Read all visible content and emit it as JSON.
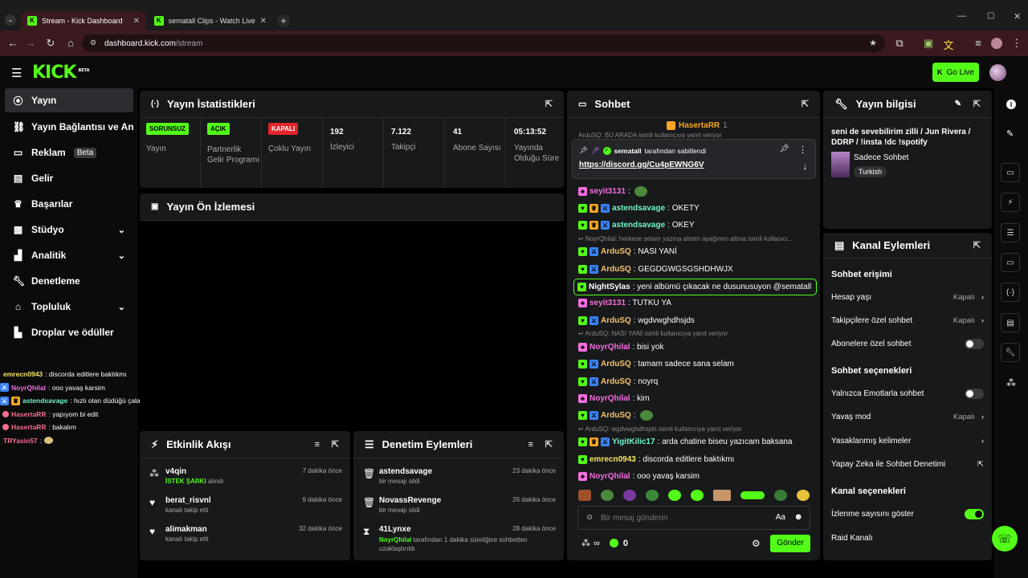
{
  "browser": {
    "tabs": [
      {
        "title": "Stream - Kick Dashboard",
        "active": true
      },
      {
        "title": "sematall Clips - Watch Live on Kick",
        "active": false
      }
    ],
    "url_host": "dashboard.kick.com",
    "url_path": "/stream"
  },
  "header": {
    "logo": "KICK",
    "logo_badge": "BETA",
    "go_live": "Go Live"
  },
  "sidebar": {
    "items": [
      {
        "label": "Yayın",
        "icon": "broadcast-icon",
        "active": true
      },
      {
        "label": "Yayın Bağlantısı ve Anahtarı",
        "icon": "link-icon"
      },
      {
        "label": "Reklam",
        "icon": "ad-icon",
        "badge": "Beta"
      },
      {
        "label": "Gelir",
        "icon": "revenue-icon"
      },
      {
        "label": "Başarılar",
        "icon": "trophy-icon"
      },
      {
        "label": "Stüdyo",
        "icon": "studio-icon",
        "expandable": true
      },
      {
        "label": "Analitik",
        "icon": "analytics-icon",
        "expandable": true
      },
      {
        "label": "Denetleme",
        "icon": "wrench-icon"
      },
      {
        "label": "Topluluk",
        "icon": "community-icon",
        "expandable": true
      },
      {
        "label": "Droplar ve ödüller",
        "icon": "drops-icon"
      }
    ],
    "mini_chat": [
      {
        "user": "emrecn0943",
        "text": " : discorda editlere baktıkmı",
        "color": "#f5e663"
      },
      {
        "user": "NoyrQhilal",
        "text": " : ooo yavaş karsim",
        "color": "#f56edf"
      },
      {
        "user": "astendsavage",
        "text": " : hızlı olan düdüğü çalar hesabı",
        "color": "#6ef5c8"
      },
      {
        "user": "HasertaRR",
        "text": " : yapıyom bi edit",
        "color": "#f56e8e"
      },
      {
        "user": "HasertaRR",
        "text": " : bakalım",
        "color": "#f56e8e"
      },
      {
        "user": "TRYasin57",
        "text": " :",
        "color": "#f56e8e"
      }
    ]
  },
  "stats": {
    "title": "Yayın İstatistikleri",
    "cells": [
      {
        "badge": "SORUNSUZ",
        "badge_color": "#53fc18",
        "label": "Yayın"
      },
      {
        "badge": "AÇIK",
        "badge_color": "#53fc18",
        "label": "Partnerlik Gelir Programı"
      },
      {
        "badge": "KAPALI",
        "badge_color": "#e3242b",
        "label": "Çoklu Yayın"
      },
      {
        "value": "192",
        "label": "İzleyici"
      },
      {
        "value": "7.122",
        "label": "Takipçi"
      },
      {
        "value": "41",
        "label": "Abone Sayısı"
      },
      {
        "value": "05:13:52",
        "label": "Yayında Olduğu Süre"
      }
    ]
  },
  "preview": {
    "title": "Yayın Ön İzlemesi"
  },
  "activity": {
    "title": "Etkinlik Akışı",
    "rows": [
      {
        "user": "v4qin",
        "sub_highlight": "İSTEK ŞARKI",
        "sub": " alındı",
        "time": "7 dakika önce",
        "icon": "redeem-icon"
      },
      {
        "user": "berat_risvnl",
        "sub": "kanalı takip etti",
        "time": "9 dakika önce",
        "icon": "heart-icon"
      },
      {
        "user": "alimakman",
        "sub": "kanalı takip etti",
        "time": "32 dakika önce",
        "icon": "heart-icon"
      }
    ]
  },
  "moderation": {
    "title": "Denetim Eylemleri",
    "rows": [
      {
        "user": "astendsavage",
        "sub": "bir mesajı sildi",
        "time": "23 dakika önce",
        "icon": "trash-icon"
      },
      {
        "user": "NovassRevenge",
        "sub": "bir mesajı sildi",
        "time": "26 dakika önce",
        "icon": "trash-icon"
      },
      {
        "user": "41Lynxe",
        "sub_highlight": "NoyrQhilal",
        "sub": " tarafından 1 dakika süreliğine sohbetten uzaklaştırıldı",
        "time": "28 dakika önce",
        "icon": "hourglass-icon"
      }
    ]
  },
  "chat": {
    "title": "Sohbet",
    "top_user": "HasertaRR",
    "top_count": "1",
    "top_reply": "ArduSQ: BU ARADA isimli kullanıcıya yanıt veriyor",
    "pinned_by": "sematall",
    "pinned_suffix": " tarafından sabitlendi",
    "pinned_link": "https://discord.gg/Cu4pEWNG6V",
    "messages": [
      {
        "user": "seyit3131",
        "text": ":",
        "color": "#f56edf",
        "emote": true
      },
      {
        "user": "astendsavage",
        "text": ": OKETY",
        "color": "#6ef5c8"
      },
      {
        "user": "astendsavage",
        "text": ": OKEY",
        "color": "#6ef5c8"
      },
      {
        "reply": "NoyrQhilal: herkese selam yazma almim ayağımın altına isimli kullanıcı..."
      },
      {
        "user": "ArduSQ",
        "text": ": NASI YANİ",
        "color": "#f5c16e"
      },
      {
        "user": "ArduSQ",
        "text": ": GEGDGWGSGSHDHWJX",
        "color": "#f5c16e"
      },
      {
        "user": "NightSylas",
        "text": ": yeni albümü çıkacak ne dusunusuyon @sematall",
        "color": "#ffffff",
        "highlight": true
      },
      {
        "user": "seyit3131",
        "text": ": TUTKU YA",
        "color": "#f56edf"
      },
      {
        "user": "ArduSQ",
        "text": ": wgdvwghdhsjds",
        "color": "#f5c16e"
      },
      {
        "reply": "ArduSQ: NASI YANİ isimli kullanıcıya yanıt veriyor"
      },
      {
        "user": "NoyrQhilal",
        "text": ": bisi yok",
        "color": "#f56edf"
      },
      {
        "user": "ArduSQ",
        "text": ": tamam sadece sana selam",
        "color": "#f5c16e"
      },
      {
        "user": "ArduSQ",
        "text": ": noyrq",
        "color": "#f5c16e"
      },
      {
        "user": "NoyrQhilal",
        "text": ": kim",
        "color": "#f56edf"
      },
      {
        "user": "ArduSQ",
        "text": ":",
        "color": "#f5c16e",
        "emote": true
      },
      {
        "reply": "ArduSQ: wgdvwghdhsjds isimli kullanıcıya yanıt veriyor"
      },
      {
        "user": "YigitKilic17",
        "text": ": arda chatine biseu yazıcam baksana",
        "color": "#6ef5c8"
      },
      {
        "user": "emrecn0943",
        "text": ": discorda editlere baktıkmı",
        "color": "#f5e663"
      },
      {
        "user": "NoyrQhilal",
        "text": ": ooo yavaş karsim",
        "color": "#f56edf"
      }
    ],
    "input_placeholder": "Bir mesaj gönderin",
    "infinity": "∞",
    "points": "0",
    "send": "Gönder"
  },
  "stream_info": {
    "title": "Yayın bilgisi",
    "stream_title": "seni de sevebilirim zilli / Jun Rivera / DDRP / !insta !dc !spotify",
    "category": "Sadece Sohbet",
    "tag": "Turkish"
  },
  "channel_actions": {
    "title": "Kanal Eylemleri",
    "chat_access": "Sohbet erişimi",
    "rows_access": [
      {
        "label": "Hesap yaşı",
        "value": "Kapalı",
        "kind": "chevron"
      },
      {
        "label": "Takipçilere özel sohbet",
        "value": "Kapalı",
        "kind": "chevron"
      },
      {
        "label": "Abonelere özel sohbet",
        "kind": "toggle",
        "on": false
      }
    ],
    "chat_options": "Sohbet seçenekleri",
    "rows_options": [
      {
        "label": "Yalnızca Emotlarla sohbet",
        "kind": "toggle",
        "on": false
      },
      {
        "label": "Yavaş mod",
        "value": "Kapalı",
        "kind": "chevron"
      },
      {
        "label": "Yasaklanmış kelimeler",
        "kind": "chevron"
      },
      {
        "label": "Yapay Zeka ile Sohbet Denetimi",
        "kind": "external"
      }
    ],
    "channel_options": "Kanal seçenekleri",
    "rows_channel": [
      {
        "label": "İzlenme sayısını göster",
        "kind": "toggle",
        "on": true
      },
      {
        "label": "Raid Kanalı",
        "kind": "none"
      }
    ]
  },
  "colors": {
    "accent": "#53fc18",
    "panel": "#18191b",
    "danger": "#e3242b"
  }
}
